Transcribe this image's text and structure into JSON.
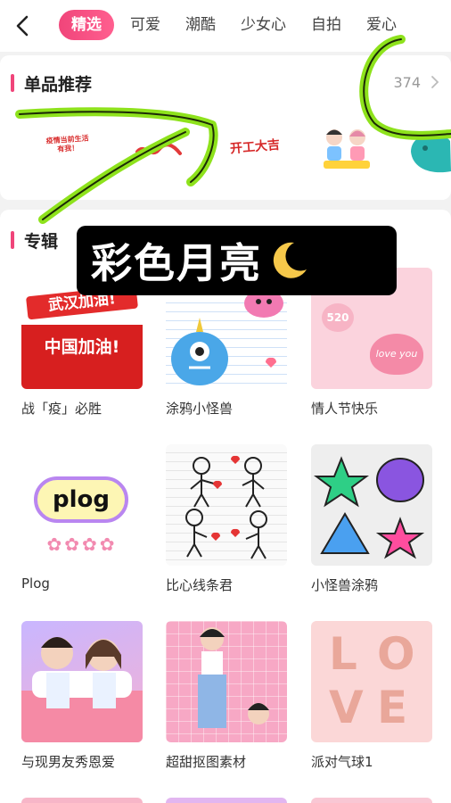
{
  "nav": {
    "tabs": [
      "精选",
      "可爱",
      "潮酷",
      "少女心",
      "自拍",
      "爱心"
    ],
    "active_index": 0
  },
  "recommend": {
    "title": "单品推荐",
    "count": "374",
    "stickers": [
      "疫情当前生活有我！",
      "开工大吉"
    ]
  },
  "albums": {
    "title": "专辑",
    "items": [
      {
        "label": "战「疫」必胜",
        "thumb_text": [
          "武汉加油!",
          "中国加油!"
        ]
      },
      {
        "label": "涂鸦小怪兽"
      },
      {
        "label": "情人节快乐",
        "thumb_text": [
          "520",
          "love you"
        ]
      },
      {
        "label": "Plog",
        "thumb_text": [
          "plog"
        ]
      },
      {
        "label": "比心线条君"
      },
      {
        "label": "小怪兽涂鸦"
      },
      {
        "label": "与现男友秀恩爱"
      },
      {
        "label": "超甜抠图素材"
      },
      {
        "label": "派对气球1",
        "thumb_text": [
          "L",
          "O",
          "V",
          "E"
        ]
      }
    ]
  },
  "caption": {
    "text": "彩色月亮"
  },
  "colors": {
    "accent": "#f0457a",
    "marker": "#8ee21c"
  }
}
